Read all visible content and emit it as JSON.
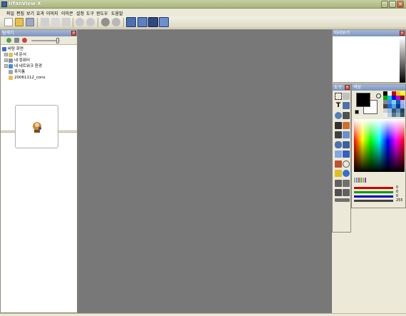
{
  "window": {
    "title": "IrfanView X"
  },
  "menu": [
    "파일",
    "편집",
    "보기",
    "효과",
    "이미지",
    "이미콘",
    "설정",
    "도구",
    "윈도우",
    "도움말"
  ],
  "explorer": {
    "title": "탐색기",
    "tree": [
      {
        "label": "바탕 화면",
        "level": 0,
        "icon_color": "#3a6fc8"
      },
      {
        "label": "내 문서",
        "level": 1,
        "icon_color": "#e8c050"
      },
      {
        "label": "내 컴퓨터",
        "level": 1,
        "icon_color": "#8090b0"
      },
      {
        "label": "내 네트워크 환경",
        "level": 1,
        "icon_color": "#4a8ac8"
      },
      {
        "label": "휴지통",
        "level": 1,
        "icon_color": "#9aa6b8"
      },
      {
        "label": "20061112_cons",
        "level": 1,
        "icon_color": "#e8c050"
      }
    ]
  },
  "preview": {
    "title": "미리보기"
  },
  "tools": {
    "title": "도구"
  },
  "colors": {
    "title": "색상",
    "sliders": [
      {
        "color": "#d00000",
        "value": "0"
      },
      {
        "color": "#00a000",
        "value": "0"
      },
      {
        "color": "#0000c0",
        "value": "0"
      },
      {
        "color": "#404040",
        "value": "255"
      }
    ]
  },
  "accent": {
    "titlebar": "#a9b67e",
    "panel_title": "#7a94c0",
    "close": "#c04a2a"
  }
}
